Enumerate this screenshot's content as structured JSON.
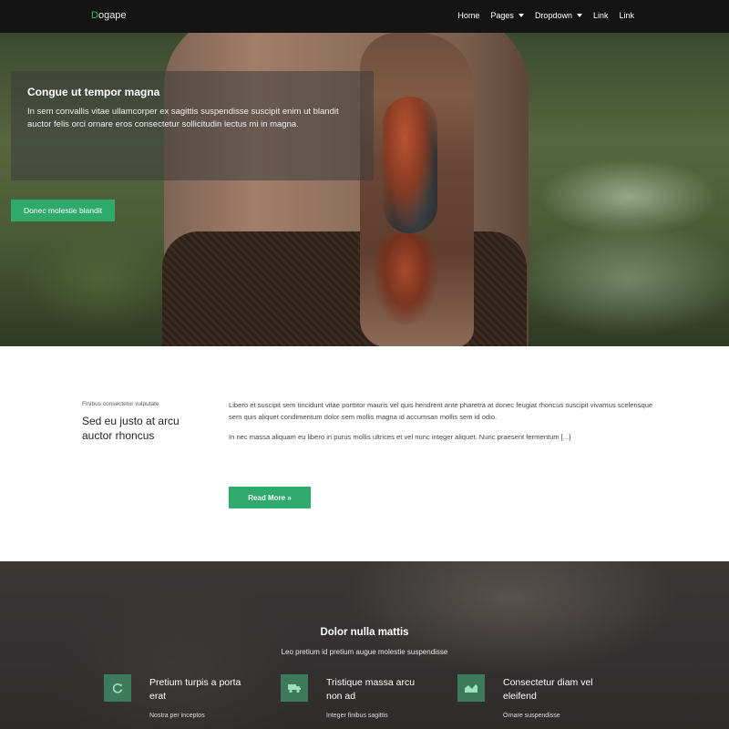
{
  "nav": {
    "brand_first": "D",
    "brand_rest": "ogape",
    "items": [
      {
        "label": "Home",
        "dropdown": false
      },
      {
        "label": "Pages",
        "dropdown": true
      },
      {
        "label": "Dropdown",
        "dropdown": true
      },
      {
        "label": "Link",
        "dropdown": false
      },
      {
        "label": "Link",
        "dropdown": false
      }
    ]
  },
  "hero": {
    "caption_title": "Congue ut tempor magna",
    "caption_text": "In sem convallis vitae ullamcorper ex sagittis suspendisse suscipit enim ut blandit auctor felis orci ornare eros consectetur sollicitudin lectus mi in magna.",
    "button_label": "Donec molestie blandit"
  },
  "intro": {
    "eyebrow": "Finibus consectetur vulputate",
    "title": "Sed eu justo at arcu auctor rhoncus",
    "paragraphs": [
      "Libero et suscipit sem tincidunt vitae porttitor mauris vel quis hendrerit ante pharetra at donec feugiat rhoncus suscipit vivamus scelerisque sem quis aliquet condimentum dolor sem mollis magna id accumsan mollis sem id odio.",
      "In nec massa aliquam eu libero in purus mollis ultrices et vel nunc integer aliquet. Nunc praesent fermentum [...]"
    ],
    "button_label": "Read More »"
  },
  "features": {
    "title": "Dolor nulla mattis",
    "subtitle": "Leo pretium id pretium augue molestie suspendisse",
    "items": [
      {
        "title": "Pretium turpis a porta erat",
        "subtitle": "Nostra per inceptos",
        "icon": "refresh-icon"
      },
      {
        "title": "Tristique massa arcu non ad",
        "subtitle": "Integer finibus sagittis",
        "icon": "truck-icon"
      },
      {
        "title": "Consectetur diam vel eleifend",
        "subtitle": "Ornare suspendisse",
        "icon": "chart-icon"
      }
    ]
  },
  "colors": {
    "accent": "#2eaa6d",
    "nav_bg": "#131413",
    "icon_bg": "#3d7a5c"
  }
}
